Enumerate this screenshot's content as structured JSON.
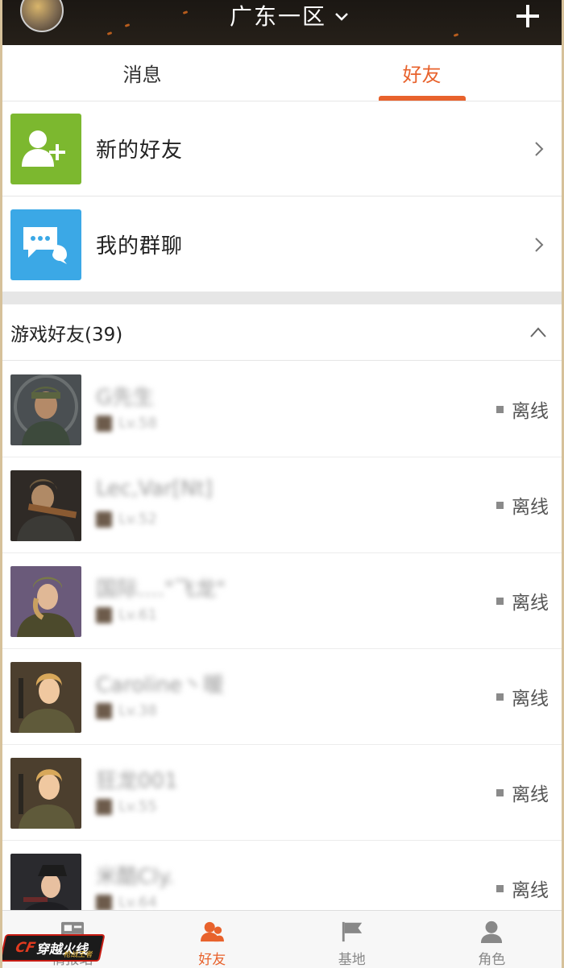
{
  "header": {
    "server_name": "广东一区",
    "dropdown_icon": "chevron-down-icon",
    "add_icon": "plus-icon"
  },
  "tabs": [
    {
      "label": "消息",
      "active": false
    },
    {
      "label": "好友",
      "active": true
    }
  ],
  "menu": [
    {
      "label": "新的好友",
      "icon": "add-friend-icon",
      "color": "#7cb82f"
    },
    {
      "label": "我的群聊",
      "icon": "group-chat-icon",
      "color": "#3ba8e6"
    }
  ],
  "friends_section": {
    "title": "游戏好友(39)",
    "collapse_icon": "chevron-up-icon"
  },
  "friends": [
    {
      "name": "G先生",
      "level": "Lv.58",
      "status": "离线"
    },
    {
      "name": "Lec,Var[Nt]",
      "level": "Lv.52",
      "status": "离线"
    },
    {
      "name": "国际....\"飞龙\"",
      "level": "Lv.61",
      "status": "离线"
    },
    {
      "name": "Caroline丶暖",
      "level": "Lv.38",
      "status": "离线"
    },
    {
      "name": "狂龙001",
      "level": "Lv.55",
      "status": "离线"
    },
    {
      "name": "米酷Cly.",
      "level": "Lv.64",
      "status": "离线"
    }
  ],
  "bottom_nav": [
    {
      "label": "情报站",
      "icon": "news-icon",
      "active": false
    },
    {
      "label": "好友",
      "icon": "friends-icon",
      "active": true
    },
    {
      "label": "基地",
      "icon": "flag-icon",
      "active": false
    },
    {
      "label": "角色",
      "icon": "profile-icon",
      "active": false
    }
  ],
  "logo": {
    "cf": "CF",
    "title": "穿越火线",
    "subtitle": "枪战王者"
  },
  "colors": {
    "accent": "#e8622c",
    "add_friend": "#7cb82f",
    "group_chat": "#3ba8e6",
    "header_bg": "#1b1713"
  }
}
